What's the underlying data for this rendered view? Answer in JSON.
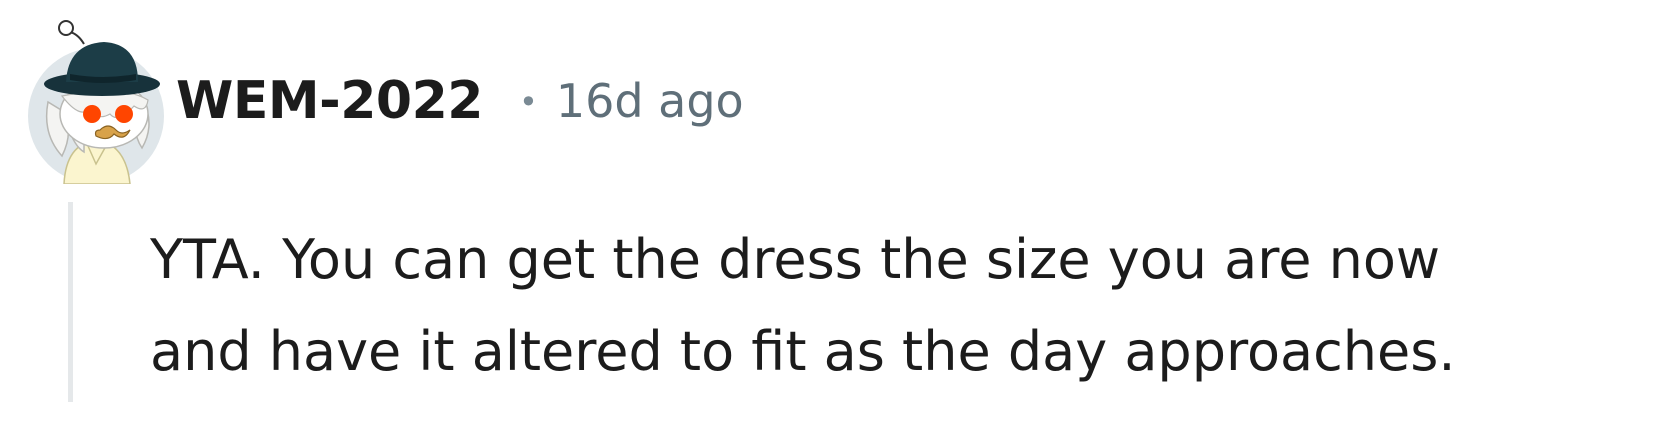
{
  "comment": {
    "author": "WEM-2022",
    "separator": "•",
    "timestamp": "16d ago",
    "body_lines": [
      "YTA. You can get the dress the size you are now",
      "and have it altered to fit as the day approaches."
    ]
  },
  "icons": {
    "avatar": "snoo-avatar-with-bowler-hat"
  },
  "colors": {
    "background": "#ffffff",
    "text": "#1c1c1c",
    "meta_text": "#5f6f79",
    "thread_line": "#e5e8ea",
    "avatar_bg": "#dfe6ea",
    "hat": "#17323b",
    "eye": "#ff4500"
  }
}
